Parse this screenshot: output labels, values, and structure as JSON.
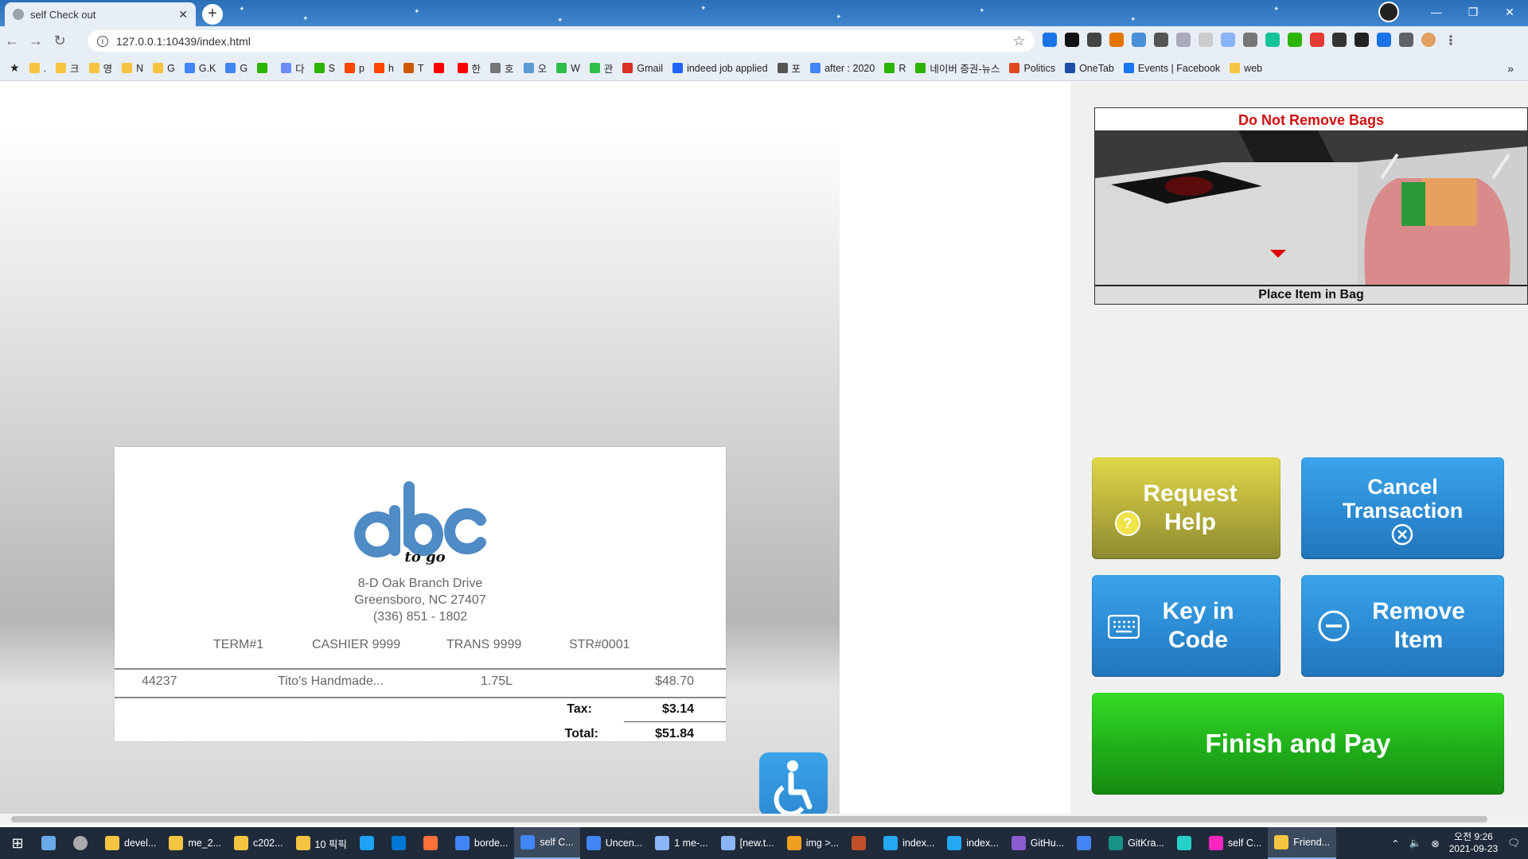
{
  "browser": {
    "tab_title": "self Check out",
    "url": "127.0.0.1:10439/index.html",
    "bookmarks": [
      {
        "label": ".",
        "color": "#f5c542"
      },
      {
        "label": "크",
        "color": "#f5c542"
      },
      {
        "label": "영",
        "color": "#f5c542"
      },
      {
        "label": "N",
        "color": "#f5c542"
      },
      {
        "label": "G",
        "color": "#f5c542"
      },
      {
        "label": "G.K",
        "color": "#4285f4"
      },
      {
        "label": "G",
        "color": "#4285f4"
      },
      {
        "label": "",
        "color": "#2db400"
      },
      {
        "label": "다",
        "color": "#6b8cff"
      },
      {
        "label": "S",
        "color": "#2db400"
      },
      {
        "label": "p",
        "color": "#ff4500"
      },
      {
        "label": "h",
        "color": "#ff4500"
      },
      {
        "label": "T",
        "color": "#d05a00"
      },
      {
        "label": "",
        "color": "#ff0000"
      },
      {
        "label": "한",
        "color": "#ff0000"
      },
      {
        "label": "호",
        "color": "#777777"
      },
      {
        "label": "오",
        "color": "#5b9bd5"
      },
      {
        "label": "W",
        "color": "#2dbf4a"
      },
      {
        "label": "관",
        "color": "#2dbf4a"
      },
      {
        "label": "Gmail",
        "color": "#d93025"
      },
      {
        "label": "indeed job applied",
        "color": "#2164f3"
      },
      {
        "label": "포",
        "color": "#555555"
      },
      {
        "label": "after : 2020",
        "color": "#4285f4"
      },
      {
        "label": "R",
        "color": "#2db400"
      },
      {
        "label": "네이버 증권-뉴스",
        "color": "#2db400"
      },
      {
        "label": "Politics",
        "color": "#e0481c"
      },
      {
        "label": "OneTab",
        "color": "#1f4fa8"
      },
      {
        "label": "Events | Facebook",
        "color": "#1877f2"
      },
      {
        "label": "web",
        "color": "#f5c542"
      }
    ]
  },
  "bag_panel": {
    "title": "Do Not Remove Bags",
    "caption": "Place Item in Bag"
  },
  "receipt": {
    "logo_text": "abc",
    "logo_tagline": "to go",
    "address_line1": "8-D Oak Branch Drive",
    "address_line2": "Greensboro, NC 27407",
    "phone": "(336) 851 - 1802",
    "term": "TERM#1",
    "cashier": "CASHIER 9999",
    "trans": "TRANS 9999",
    "store": "STR#0001",
    "items": [
      {
        "code": "44237",
        "name": "Tito's Handmade...",
        "size": "1.75L",
        "price": "$48.70"
      }
    ],
    "tax_label": "Tax:",
    "tax_value": "$3.14",
    "total_label": "Total:",
    "total_value": "$51.84"
  },
  "buttons": {
    "request_help": [
      "Request",
      "Help"
    ],
    "cancel_transaction": [
      "Cancel",
      "Transaction"
    ],
    "key_in_code": [
      "Key in",
      "Code"
    ],
    "remove_item": [
      "Remove",
      "Item"
    ],
    "finish_and_pay": "Finish and Pay"
  },
  "taskbar": {
    "items": [
      {
        "label": "devel...",
        "color": "#f5c542",
        "active": false
      },
      {
        "label": "me_2...",
        "color": "#f5c542",
        "active": false
      },
      {
        "label": "c202...",
        "color": "#f5c542",
        "active": false
      },
      {
        "label": "10 픽픽",
        "color": "#f5c542",
        "active": false
      },
      {
        "label": "",
        "color": "#1da1f2",
        "active": false
      },
      {
        "label": "",
        "color": "#0078d7",
        "active": false
      },
      {
        "label": "",
        "color": "#ff7139",
        "active": false
      },
      {
        "label": "borde...",
        "color": "#4285f4",
        "active": false
      },
      {
        "label": "self C...",
        "color": "#4285f4",
        "active": true
      },
      {
        "label": "Uncen...",
        "color": "#4285f4",
        "active": false
      },
      {
        "label": "1 me-...",
        "color": "#8ab4f8",
        "active": false
      },
      {
        "label": "[new.t...",
        "color": "#8ab4f8",
        "active": false
      },
      {
        "label": "img >...",
        "color": "#f0a020",
        "active": false
      },
      {
        "label": "",
        "color": "#c0502a",
        "active": false
      },
      {
        "label": "index...",
        "color": "#23a9f2",
        "active": false
      },
      {
        "label": "index...",
        "color": "#23a9f2",
        "active": false
      },
      {
        "label": "GitHu...",
        "color": "#8a5cd0",
        "active": false
      },
      {
        "label": "",
        "color": "#4285f4",
        "active": false
      },
      {
        "label": "GitKra...",
        "color": "#179287",
        "active": false
      },
      {
        "label": "",
        "color": "#25d0c8",
        "active": false
      },
      {
        "label": "self C...",
        "color": "#ff26be",
        "active": false
      },
      {
        "label": "Friend...",
        "color": "#f5c542",
        "active": true
      }
    ],
    "clock_time": "오전 9:26",
    "clock_date": "2021-09-23"
  },
  "colors": {
    "help_button": "#c5bd3f",
    "blue_button": "#2b8ad1",
    "finish_button": "#22b71a",
    "bag_title": "#d01010"
  }
}
